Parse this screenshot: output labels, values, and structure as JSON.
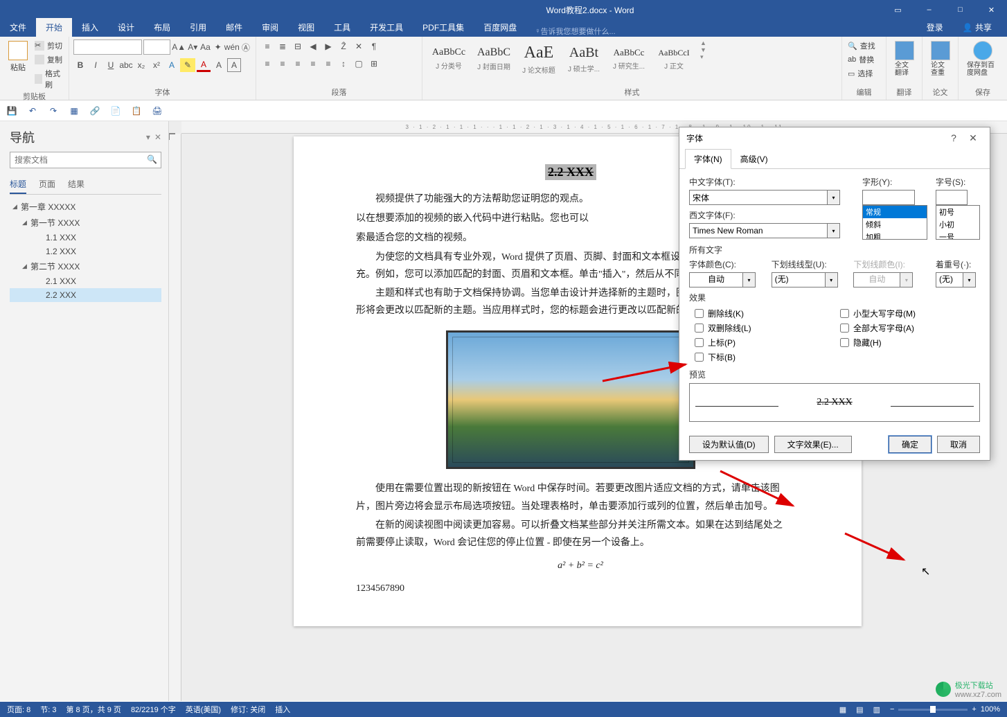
{
  "title_bar": {
    "title": "Word教程2.docx - Word"
  },
  "win_buttons": [
    "▭",
    "–",
    "□",
    "✕"
  ],
  "ribbon_tabs": [
    "文件",
    "开始",
    "插入",
    "设计",
    "布局",
    "引用",
    "邮件",
    "审阅",
    "视图",
    "工具",
    "开发工具",
    "PDF工具集",
    "百度网盘"
  ],
  "ribbon_active": 1,
  "tell_me": "告诉我您想要做什么...",
  "ribbon_right": [
    "登录",
    "共享"
  ],
  "groups": {
    "clipboard": {
      "label": "剪贴板",
      "paste": "粘贴",
      "cut": "剪切",
      "copy": "复制",
      "painter": "格式刷"
    },
    "font": {
      "label": "字体",
      "name": "",
      "size": ""
    },
    "para": {
      "label": "段落"
    },
    "styles": {
      "label": "样式",
      "items": [
        {
          "preview": "AaBbCc",
          "name": "J 分类号"
        },
        {
          "preview": "AaBbC",
          "name": "J 封面日期"
        },
        {
          "preview": "AaE",
          "name": "J 论文标题"
        },
        {
          "preview": "AaBt",
          "name": "J 硕士学..."
        },
        {
          "preview": "AaBbCc",
          "name": "J 研究生..."
        },
        {
          "preview": "AaBbCcI",
          "name": "J 正文"
        }
      ]
    },
    "edit": {
      "label": "编辑",
      "find": "查找",
      "replace": "替换",
      "select": "选择"
    },
    "trans": {
      "label": "翻译",
      "full": "全文翻译"
    },
    "thesis": {
      "label": "论文",
      "check": "论文查重"
    },
    "save": {
      "label": "保存",
      "baidu": "保存到百度网盘"
    }
  },
  "nav": {
    "title": "导航",
    "search_ph": "搜索文档",
    "tabs": [
      "标题",
      "页面",
      "结果"
    ],
    "tree": [
      {
        "lvl": 1,
        "exp": true,
        "label": "第一章 XXXXX"
      },
      {
        "lvl": 2,
        "exp": true,
        "label": "第一节 XXXX"
      },
      {
        "lvl": 3,
        "label": "1.1 XXX"
      },
      {
        "lvl": 3,
        "label": "1.2 XXX"
      },
      {
        "lvl": 2,
        "exp": true,
        "label": "第二节 XXXX"
      },
      {
        "lvl": 3,
        "label": "2.1 XXX"
      },
      {
        "lvl": 3,
        "sel": true,
        "label": "2.2 XXX"
      }
    ]
  },
  "ruler": "3 · 1 · 2 · 1 · 1 · 1 · · · 1 · 1 · 2 · 1 · 3 · 1 · 4 · 1 · 5 · 1 · 6 · 1 · 7 · 1 · 8 · 1 · 9 · 1 · 10 · 1 · 11",
  "doc": {
    "heading": "2.2 XXX",
    "p1": "视频提供了功能强大的方法帮助您证明您的观点。",
    "p1b": "以在想要添加的视频的嵌入代码中进行粘贴。您也可以",
    "p1c": "索最适合您的文档的视频。",
    "p2": "为使您的文档具有专业外观，Word 提供了页眉、页脚、封面和文本框设计，这些设计可互为补充。例如，您可以添加匹配的封面、页眉和文本框。单击\"插入\"，然后从不同库中选择所需元素。",
    "p3": "主题和样式也有助于文档保持协调。当您单击设计并选择新的主题时，图片、图表或 SmartArt 图形将会更改以匹配新的主题。当应用样式时，您的标题会进行更改以匹配新的主题。",
    "p4": "使用在需要位置出现的新按钮在 Word 中保存时间。若要更改图片适应文档的方式，请单击该图片，图片旁边将会显示布局选项按钮。当处理表格时，单击要添加行或列的位置，然后单击加号。",
    "p5": "在新的阅读视图中阅读更加容易。可以折叠文档某些部分并关注所需文本。如果在达到结尾处之前需要停止读取，Word 会记住您的停止位置 - 即使在另一个设备上。",
    "nums": "1234567890",
    "formula": "a² + b² = c²"
  },
  "dialog": {
    "title": "字体",
    "tabs": [
      "字体(N)",
      "高级(V)"
    ],
    "cn_font_label": "中文字体(T):",
    "cn_font": "宋体",
    "style_label": "字形(Y):",
    "style_items": [
      "常规",
      "倾斜",
      "加粗"
    ],
    "size_label": "字号(S):",
    "size_items": [
      "初号",
      "小初",
      "一号"
    ],
    "west_font_label": "西文字体(F):",
    "west_font": "Times New Roman",
    "all_text": "所有文字",
    "color_label": "字体颜色(C):",
    "color": "自动",
    "ul_label": "下划线线型(U):",
    "ul": "(无)",
    "ulc_label": "下划线颜色(I):",
    "ulc": "自动",
    "em_label": "着重号(·):",
    "em": "(无)",
    "effects": "效果",
    "chk": [
      "删除线(K)",
      "双删除线(L)",
      "上标(P)",
      "下标(B)"
    ],
    "chk_r": [
      "小型大写字母(M)",
      "全部大写字母(A)",
      "隐藏(H)"
    ],
    "preview_label": "预览",
    "preview_text": "2.2 XXX",
    "btn_default": "设为默认值(D)",
    "btn_effects": "文字效果(E)...",
    "ok": "确定",
    "cancel": "取消"
  },
  "status": {
    "page": "页面: 8",
    "sec": "节: 3",
    "pages": "第 8 页，共 9 页",
    "words": "82/2219 个字",
    "lang": "英语(美国)",
    "track": "修订: 关闭",
    "ins": "插入",
    "zoom": "100%"
  },
  "watermark": {
    "site": "极光下载站",
    "url": "www.xz7.com"
  }
}
